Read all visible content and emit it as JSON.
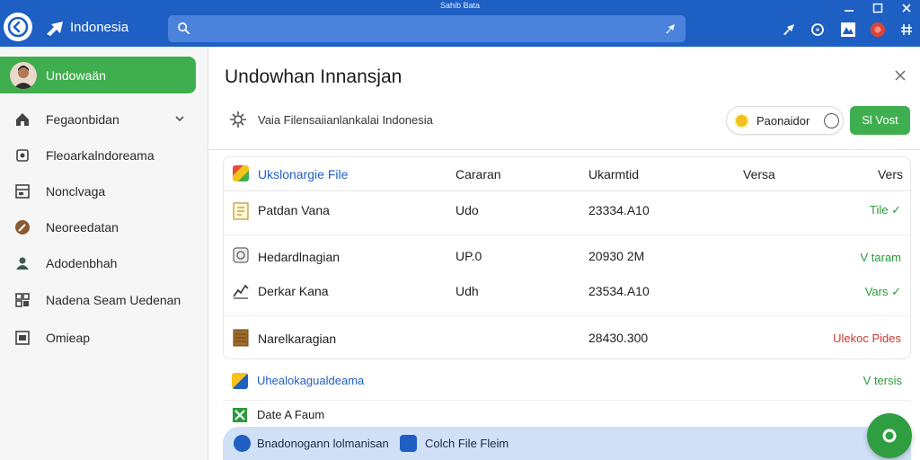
{
  "window": {
    "title": "Sahib Bata"
  },
  "header": {
    "app_name": "Indonesia",
    "search": {
      "placeholder": ""
    }
  },
  "sidebar": {
    "active": {
      "label": "Undowaän"
    },
    "items": [
      {
        "label": "Fegaonbidan",
        "icon": "home-icon"
      },
      {
        "label": "Fleoarkalndoreama",
        "icon": "settings-icon"
      },
      {
        "label": "Nonclvaga",
        "icon": "grid-icon"
      },
      {
        "label": "Neoreedatan",
        "icon": "wrench-icon"
      },
      {
        "label": "Adodenbhah",
        "icon": "users-icon"
      },
      {
        "label": "Nadena Seam Uedenan",
        "icon": "apps-icon"
      },
      {
        "label": "Omieap",
        "icon": "window-icon"
      }
    ]
  },
  "main": {
    "title": "Undowhan Innansjan",
    "subheading": "Vaia Filensaiianlankalai Indonesia",
    "pill_button": "Paonaidor",
    "green_button": "Sl Vost",
    "table": {
      "headers": [
        "Ukslonargie File",
        "Cararan",
        "Ukarmtid",
        "Versa",
        "Vers"
      ],
      "rows": [
        {
          "name": "Patdan Vana",
          "col2": "Udo",
          "col3": "23334.A10",
          "status": "Tile ✓",
          "status_color": "green"
        },
        {
          "name": "Hedardlnagian",
          "col2": "UP.0",
          "col3": "20930 2M",
          "status": "V taram",
          "status_color": "green"
        },
        {
          "name": "Derkar Kana",
          "col2": "Udh",
          "col3": "23534.A10",
          "status": "Vars ✓",
          "status_color": "green"
        },
        {
          "name": "Narelkaragian",
          "col2": "",
          "col3": "28430.300",
          "status": "Ulekoc Pides",
          "status_color": "red"
        }
      ]
    },
    "group1": {
      "label": "Uhealokagualdeama",
      "right": "V tersis"
    },
    "group2": {
      "label": "Date A Faum"
    },
    "bottom_bar": {
      "left": "Bnadonogann lolmanisan",
      "right": "Colch File Fleim"
    },
    "accent_blue": "#1e5fc4",
    "accent_green": "#3fae4e"
  }
}
